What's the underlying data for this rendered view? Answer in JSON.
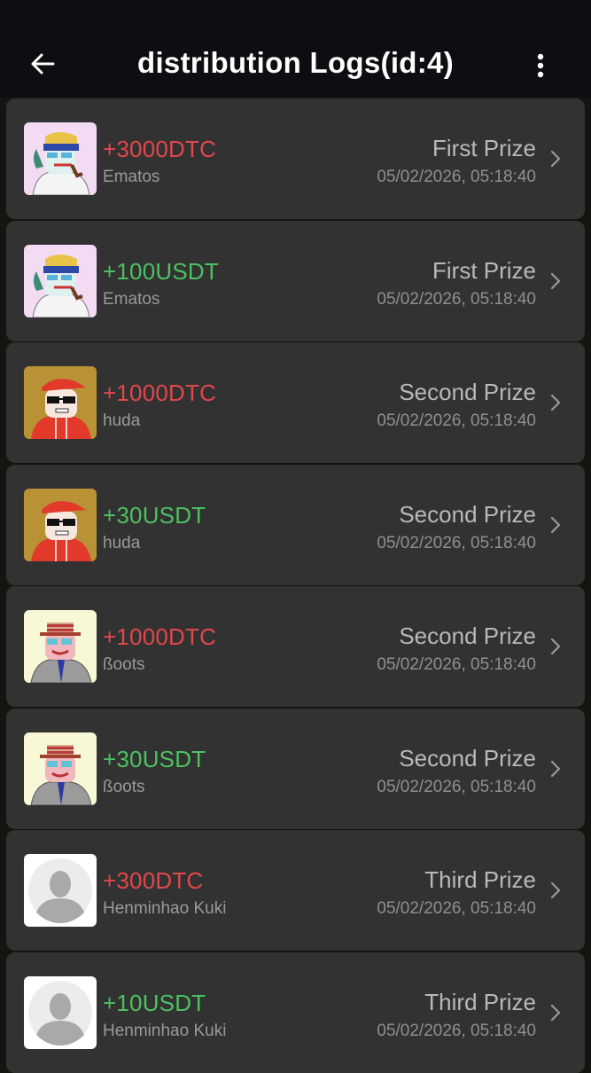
{
  "header": {
    "title": "distribution Logs(id:4)",
    "back_icon": "arrow-left-icon",
    "more_icon": "more-vertical-icon"
  },
  "colors": {
    "dtc": "#e2474a",
    "usdt": "#4cc160",
    "card_bg": "#323232",
    "header_bg": "#0c0e12"
  },
  "logs": [
    {
      "amount": "+3000DTC",
      "currency": "DTC",
      "user": "Ematos",
      "prize": "First Prize",
      "time": "05/02/2026, 05:18:40",
      "avatar": "ematos-avatar"
    },
    {
      "amount": "+100USDT",
      "currency": "USDT",
      "user": "Ematos",
      "prize": "First Prize",
      "time": "05/02/2026, 05:18:40",
      "avatar": "ematos-avatar"
    },
    {
      "amount": "+1000DTC",
      "currency": "DTC",
      "user": "huda",
      "prize": "Second Prize",
      "time": "05/02/2026, 05:18:40",
      "avatar": "huda-avatar"
    },
    {
      "amount": "+30USDT",
      "currency": "USDT",
      "user": "huda",
      "prize": "Second Prize",
      "time": "05/02/2026, 05:18:40",
      "avatar": "huda-avatar"
    },
    {
      "amount": "+1000DTC",
      "currency": "DTC",
      "user": "ßoots",
      "prize": "Second Prize",
      "time": "05/02/2026, 05:18:40",
      "avatar": "boots-avatar"
    },
    {
      "amount": "+30USDT",
      "currency": "USDT",
      "user": "ßoots",
      "prize": "Second Prize",
      "time": "05/02/2026, 05:18:40",
      "avatar": "boots-avatar"
    },
    {
      "amount": "+300DTC",
      "currency": "DTC",
      "user": "Henminhao Kuki",
      "prize": "Third Prize",
      "time": "05/02/2026, 05:18:40",
      "avatar": "default-avatar"
    },
    {
      "amount": "+10USDT",
      "currency": "USDT",
      "user": "Henminhao Kuki",
      "prize": "Third Prize",
      "time": "05/02/2026, 05:18:40",
      "avatar": "default-avatar"
    }
  ]
}
